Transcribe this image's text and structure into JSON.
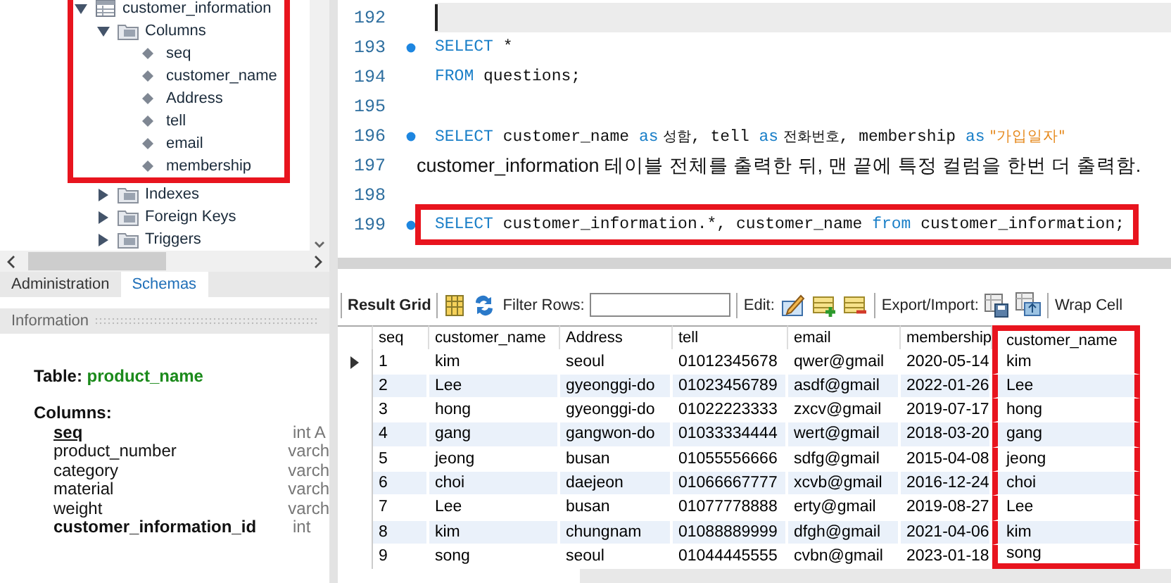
{
  "schema_tree": {
    "nodes": [
      {
        "kind": "table",
        "label": "customer_information",
        "expanded": true,
        "highlighted": true,
        "children": [
          {
            "kind": "folder",
            "label": "Columns",
            "expanded": true,
            "highlighted": true,
            "children": [
              {
                "kind": "column",
                "label": "seq"
              },
              {
                "kind": "column",
                "label": "customer_name"
              },
              {
                "kind": "column",
                "label": "Address"
              },
              {
                "kind": "column",
                "label": "tell"
              },
              {
                "kind": "column",
                "label": "email"
              },
              {
                "kind": "column",
                "label": "membership"
              }
            ]
          },
          {
            "kind": "folder",
            "label": "Indexes",
            "expanded": false,
            "highlighted": false
          },
          {
            "kind": "folder",
            "label": "Foreign Keys",
            "expanded": false,
            "highlighted": false
          },
          {
            "kind": "folder",
            "label": "Triggers",
            "expanded": false,
            "highlighted": false
          }
        ]
      }
    ]
  },
  "sidebar_tabs": [
    {
      "label": "Administration",
      "selected": false
    },
    {
      "label": "Schemas",
      "selected": true
    }
  ],
  "information": {
    "title": "Information",
    "table_label": "Table:",
    "table_name": "product_name",
    "columns_label": "Columns:",
    "columns": [
      {
        "kind": "key",
        "name": "seq",
        "type": "int A"
      },
      {
        "kind": "plain",
        "name": "product_number",
        "type": "varch"
      },
      {
        "kind": "plain",
        "name": "category",
        "type": "varch"
      },
      {
        "kind": "plain",
        "name": "material",
        "type": "varch"
      },
      {
        "kind": "plain",
        "name": "weight",
        "type": "varch"
      },
      {
        "kind": "foreign",
        "name": "customer_information_id",
        "type": "int"
      }
    ]
  },
  "editor": {
    "lines": [
      {
        "number": "192",
        "kind": "code",
        "marker": false,
        "current": true,
        "highlighted": false
      },
      {
        "number": "193",
        "kind": "code",
        "marker": true,
        "current": false,
        "highlighted": false,
        "tokens": [
          {
            "kind": "keyword",
            "text": "SELECT"
          },
          {
            "kind": "plain",
            "text": " *"
          }
        ]
      },
      {
        "number": "194",
        "kind": "code",
        "marker": false,
        "current": false,
        "highlighted": false,
        "tokens": [
          {
            "kind": "keyword",
            "text": "FROM"
          },
          {
            "kind": "plain",
            "text": " questions;"
          }
        ]
      },
      {
        "number": "195",
        "kind": "code",
        "marker": false,
        "current": false,
        "highlighted": false
      },
      {
        "number": "196",
        "kind": "code",
        "marker": true,
        "current": false,
        "highlighted": false,
        "tokens": [
          {
            "kind": "keyword",
            "text": "SELECT"
          },
          {
            "kind": "plain",
            "text": " customer_name "
          },
          {
            "kind": "keyword",
            "text": "as"
          },
          {
            "kind": "hangul",
            "text": " 성함"
          },
          {
            "kind": "plain",
            "text": ", tell "
          },
          {
            "kind": "keyword",
            "text": "as"
          },
          {
            "kind": "hangul",
            "text": " 전화번호"
          },
          {
            "kind": "plain",
            "text": ", membership "
          },
          {
            "kind": "keyword",
            "text": "as"
          },
          {
            "kind": "string",
            "text": " \"가입일자\""
          }
        ]
      },
      {
        "number": "197",
        "kind": "note",
        "marker": false,
        "current": false,
        "highlighted": false,
        "tokens": [
          {
            "kind": "plain",
            "text": "customer_information 테이블 전체를 출력한 뒤, 맨 끝에 특정 컬럼을 한번 더 출력함."
          }
        ]
      },
      {
        "number": "198",
        "kind": "code",
        "marker": false,
        "current": false,
        "highlighted": false
      },
      {
        "number": "199",
        "kind": "code",
        "marker": true,
        "current": false,
        "highlighted": true,
        "tokens": [
          {
            "kind": "keyword",
            "text": "SELECT"
          },
          {
            "kind": "plain",
            "text": " customer_information.*, customer_name "
          },
          {
            "kind": "keyword",
            "text": "from"
          },
          {
            "kind": "plain",
            "text": " customer_information;"
          }
        ]
      }
    ]
  },
  "result_toolbar": {
    "result_grid": "Result Grid",
    "filter_label": "Filter Rows:",
    "edit_label": "Edit:",
    "export_label": "Export/Import:",
    "wrap_label": "Wrap Cell"
  },
  "result_grid": {
    "columns": [
      {
        "label": "seq",
        "highlighted": false
      },
      {
        "label": "customer_name",
        "highlighted": false
      },
      {
        "label": "Address",
        "highlighted": false
      },
      {
        "label": "tell",
        "highlighted": false
      },
      {
        "label": "email",
        "highlighted": false
      },
      {
        "label": "membership",
        "highlighted": false
      },
      {
        "label": "customer_name",
        "highlighted": true
      }
    ],
    "rows": [
      {
        "current": true,
        "cells": [
          "1",
          "kim",
          "seoul",
          "01012345678",
          "qwer@gmail",
          "2020-05-14",
          "kim"
        ]
      },
      {
        "current": false,
        "cells": [
          "2",
          "Lee",
          "gyeonggi-do",
          "01023456789",
          "asdf@gmail",
          "2022-01-26",
          "Lee"
        ]
      },
      {
        "current": false,
        "cells": [
          "3",
          "hong",
          "gyeonggi-do",
          "01022223333",
          "zxcv@gmail",
          "2019-07-17",
          "hong"
        ]
      },
      {
        "current": false,
        "cells": [
          "4",
          "gang",
          "gangwon-do",
          "01033334444",
          "wert@gmail",
          "2018-03-20",
          "gang"
        ]
      },
      {
        "current": false,
        "cells": [
          "5",
          "jeong",
          "busan",
          "01055556666",
          "sdfg@gmail",
          "2015-04-08",
          "jeong"
        ]
      },
      {
        "current": false,
        "cells": [
          "6",
          "choi",
          "daejeon",
          "01066667777",
          "xcvb@gmail",
          "2016-12-24",
          "choi"
        ]
      },
      {
        "current": false,
        "cells": [
          "7",
          "Lee",
          "busan",
          "01077778888",
          "erty@gmail",
          "2019-08-27",
          "Lee"
        ]
      },
      {
        "current": false,
        "cells": [
          "8",
          "kim",
          "chungnam",
          "01088889999",
          "dfgh@gmail",
          "2021-04-06",
          "kim"
        ]
      },
      {
        "current": false,
        "cells": [
          "9",
          "song",
          "seoul",
          "01044445555",
          "cvbn@gmail",
          "2023-01-18",
          "song"
        ]
      }
    ]
  }
}
